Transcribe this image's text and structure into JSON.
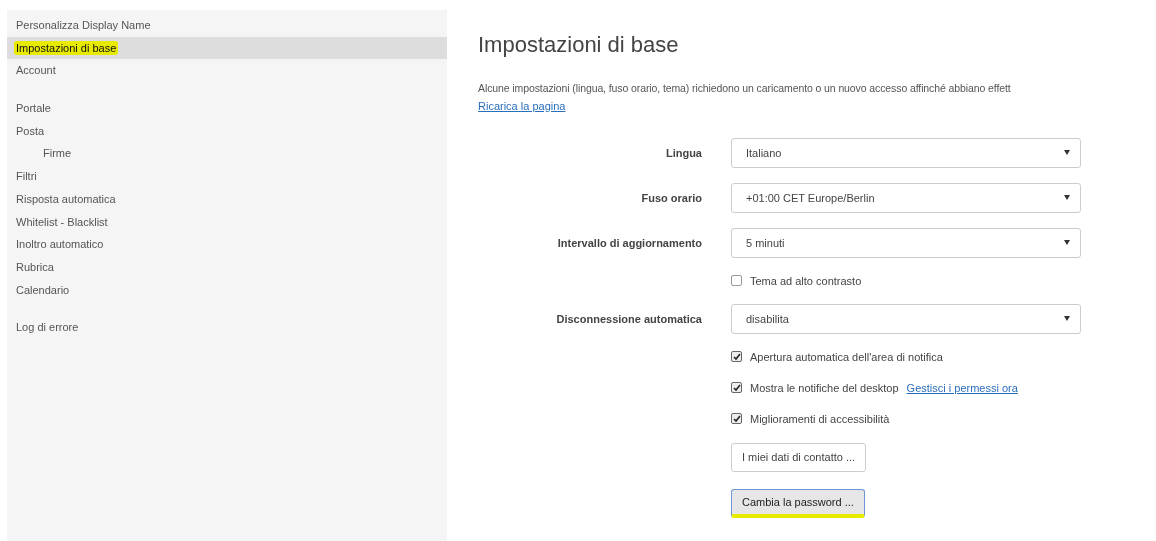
{
  "sidebar": {
    "groups": [
      {
        "items": [
          {
            "label": "Personalizza Display Name",
            "selected": false,
            "highlighted": false
          },
          {
            "label": "Impostazioni di base",
            "selected": true,
            "highlighted": true
          },
          {
            "label": "Account",
            "selected": false,
            "highlighted": false
          }
        ]
      },
      {
        "items": [
          {
            "label": "Portale",
            "selected": false,
            "highlighted": false
          },
          {
            "label": "Posta",
            "selected": false,
            "highlighted": false,
            "children": [
              {
                "label": "Firme",
                "selected": false,
                "highlighted": false
              }
            ]
          },
          {
            "label": "Filtri",
            "selected": false,
            "highlighted": false
          },
          {
            "label": "Risposta automatica",
            "selected": false,
            "highlighted": false
          },
          {
            "label": "Whitelist - Blacklist",
            "selected": false,
            "highlighted": false
          },
          {
            "label": "Inoltro automatico",
            "selected": false,
            "highlighted": false
          },
          {
            "label": "Rubrica",
            "selected": false,
            "highlighted": false
          },
          {
            "label": "Calendario",
            "selected": false,
            "highlighted": false
          }
        ]
      },
      {
        "items": [
          {
            "label": "Log di errore",
            "selected": false,
            "highlighted": false
          }
        ]
      }
    ]
  },
  "main": {
    "title": "Impostazioni di base",
    "notice": "Alcune impostazioni (lingua, fuso orario, tema) richiedono un caricamento o un nuovo accesso affinché abbiano effett",
    "reload_link": "Ricarica la pagina",
    "form": [
      {
        "kind": "select",
        "label": "Lingua",
        "value": "Italiano"
      },
      {
        "kind": "select",
        "label": "Fuso orario",
        "value": "+01:00 CET Europe/Berlin"
      },
      {
        "kind": "select",
        "label": "Intervallo di aggiornamento",
        "value": "5 minuti"
      },
      {
        "kind": "checkbox",
        "label": "Tema ad alto contrasto",
        "checked": false
      },
      {
        "kind": "select",
        "label": "Disconnessione automatica",
        "value": "disabilita"
      },
      {
        "kind": "checkbox",
        "label": "Apertura automatica dell'area di notifica",
        "checked": true
      },
      {
        "kind": "checkbox",
        "label": "Mostra le notifiche del desktop",
        "checked": true,
        "link": "Gestisci i permessi ora"
      },
      {
        "kind": "checkbox",
        "label": "Miglioramenti di accessibilità",
        "checked": true
      },
      {
        "kind": "button",
        "label": "I miei dati di contatto ...",
        "focused": false,
        "highlighted": false
      },
      {
        "kind": "button",
        "label": "Cambia la password ...",
        "focused": true,
        "highlighted": true
      }
    ]
  }
}
